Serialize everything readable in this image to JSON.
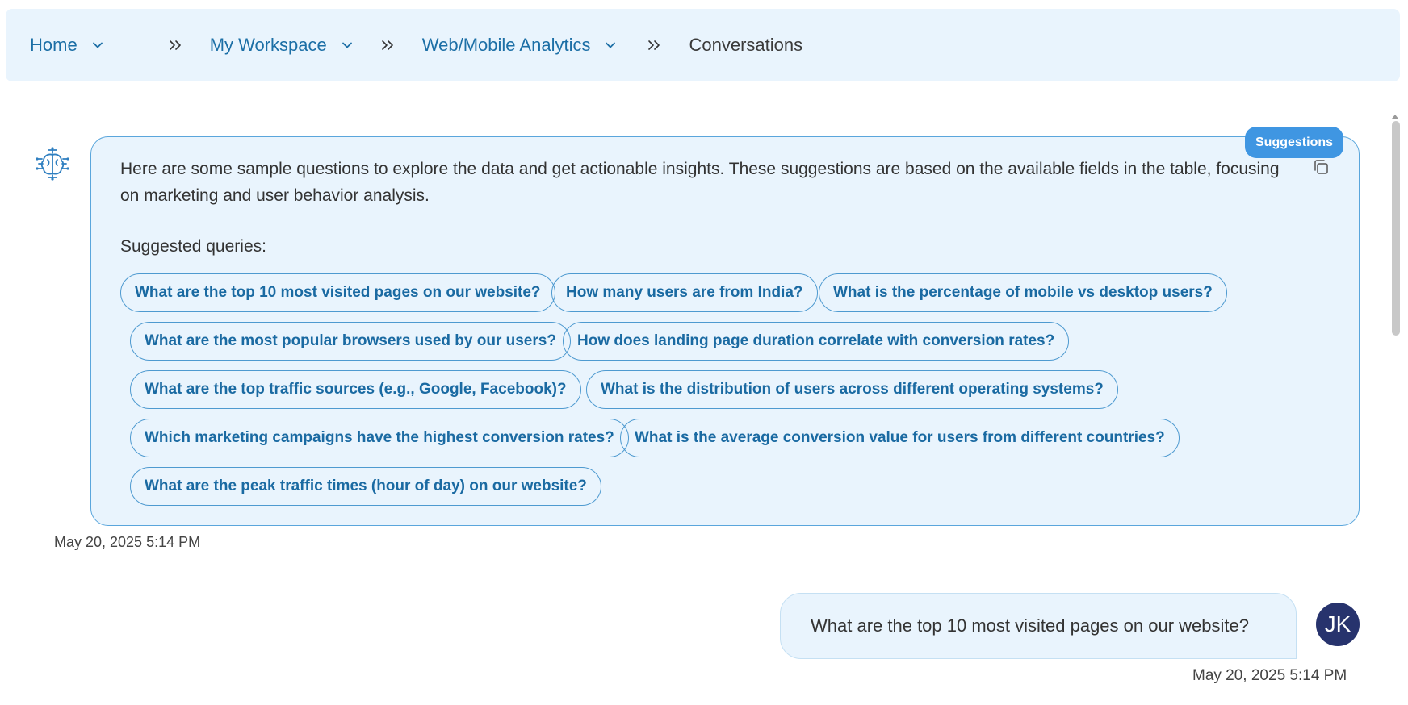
{
  "breadcrumb": {
    "items": [
      {
        "label": "Home"
      },
      {
        "label": "My Workspace"
      },
      {
        "label": "Web/Mobile Analytics"
      }
    ],
    "current": "Conversations"
  },
  "assistant": {
    "badge": "Suggestions",
    "intro": "Here are some sample questions to explore the data and get actionable insights. These suggestions are based on the available fields in the table, focusing on marketing and user behavior analysis.",
    "suggested_label": "Suggested queries:",
    "chips": [
      "What are the top 10 most visited pages on our website?",
      "How many users are from India?",
      "What is the percentage of mobile vs desktop users?",
      "What are the most popular browsers used by our users?",
      "How does landing page duration correlate with conversion rates?",
      "What are the top traffic sources (e.g., Google, Facebook)?",
      "What is the distribution of users across different operating systems?",
      "Which marketing campaigns have the highest conversion rates?",
      "What is the average conversion value for users from different countries?",
      "What are the peak traffic times (hour of day) on our website?"
    ],
    "timestamp": "May 20, 2025 5:14 PM"
  },
  "user": {
    "message": "What are the top 10 most visited pages on our website?",
    "initials": "JK",
    "timestamp": "May 20, 2025 5:14 PM"
  },
  "colors": {
    "accent": "#1c6fa6",
    "bubble_bg": "#e9f4fd",
    "badge_bg": "#3f96e2",
    "avatar_bg": "#27336d"
  },
  "icons": {
    "crumb_dropdown": "chevron-down-icon",
    "crumb_separator": "double-chevron-right-icon",
    "bot": "ai-brain-icon",
    "copy": "copy-icon"
  }
}
